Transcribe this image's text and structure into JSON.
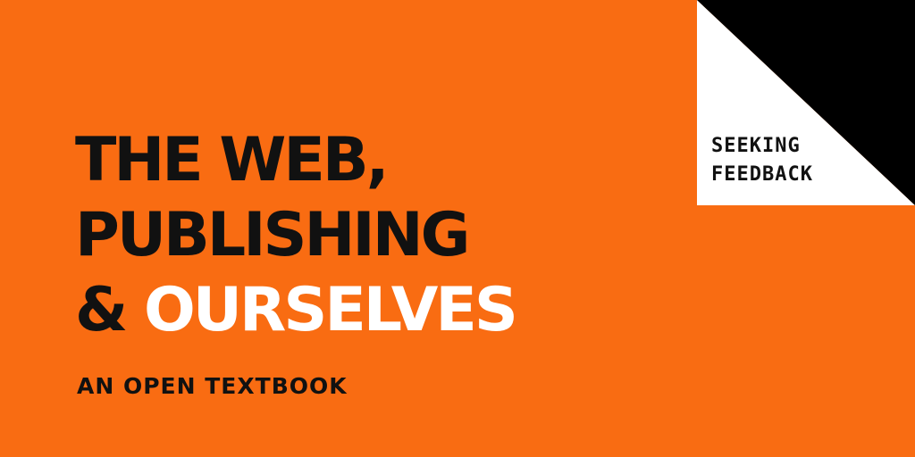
{
  "background_color": "#f96c12",
  "title": {
    "line1": "THE WEB,",
    "line2": "PUBLISHING",
    "line3_prefix": "&",
    "line3_highlight": "OURSELVES",
    "text_color": "#111111",
    "highlight_color": "#ffffff"
  },
  "subtitle": "AN OPEN TEXTBOOK",
  "badge": {
    "line1": "SEEKING",
    "line2": "FEEDBACK",
    "panel_color": "#ffffff",
    "accent_color": "#000000"
  }
}
